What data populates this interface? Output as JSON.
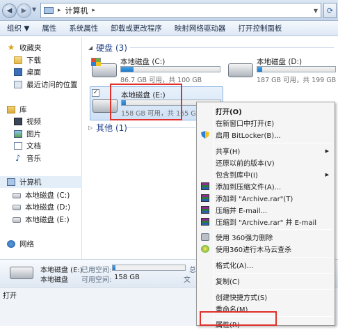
{
  "address": {
    "crumbs": [
      "计算机"
    ],
    "separator": "▸"
  },
  "toolbar": {
    "items": [
      "组织 ▼",
      "属性",
      "系统属性",
      "卸载或更改程序",
      "映射网络驱动器",
      "打开控制面板"
    ]
  },
  "sidebar": {
    "favorites": "收藏夹",
    "downloads": "下载",
    "desktop": "桌面",
    "recent": "最近访问的位置",
    "libraries": "库",
    "videos": "视频",
    "pictures": "图片",
    "documents": "文档",
    "music": "音乐",
    "computer": "计算机",
    "disk_c": "本地磁盘 (C:)",
    "disk_d": "本地磁盘 (D:)",
    "disk_e": "本地磁盘 (E:)",
    "network": "网络"
  },
  "main": {
    "hard_disks_header": "硬盘 (3)",
    "other_header": "其他 (1)",
    "drives": [
      {
        "name": "本地磁盘 (C:)",
        "info": "86.7 GB 可用，共 100 GB",
        "used_fraction": 0.13
      },
      {
        "name": "本地磁盘 (D:)",
        "info": "187 GB 可用，共 199 GB",
        "used_fraction": 0.06
      },
      {
        "name": "本地磁盘 (E:)",
        "info": "158 GB 可用，共 165 GB",
        "used_fraction": 0.04
      }
    ]
  },
  "details": {
    "name": "本地磁盘 (E:)",
    "type": "本地磁盘",
    "used_label": "已用空间:",
    "free_label": "可用空间:",
    "free_value": "158 GB",
    "used_fraction": 0.04,
    "fs_label_partial": "文",
    "extra_partial": "总"
  },
  "status": {
    "text": "打开"
  },
  "context_menu": {
    "open": "打开(O)",
    "open_new_window": "在新窗口中打开(E)",
    "bitlocker": "启用 BitLocker(B)...",
    "share": "共享(H)",
    "restore": "还原以前的版本(V)",
    "include_library": "包含到库中(I)",
    "add_archive": "添加到压缩文件(A)...",
    "add_rar": "添加到 \"Archive.rar\"(T)",
    "compress_email": "压缩并 E-mail...",
    "compress_rar_email": "压缩到 \"Archive.rar\" 并 E-mail",
    "force_delete": "使用 360强力删除",
    "trojan_scan": "使用360进行木马云查杀",
    "format": "格式化(A)...",
    "copy": "复制(C)",
    "create_shortcut": "创建快捷方式(S)",
    "rename": "重命名(M)",
    "properties": "属性(R)",
    "submenu_arrow": "▶"
  },
  "colors": {
    "highlight_box": "#e0302a",
    "bar_fill": "#1e78c8",
    "group_header": "#1e3f8a"
  }
}
